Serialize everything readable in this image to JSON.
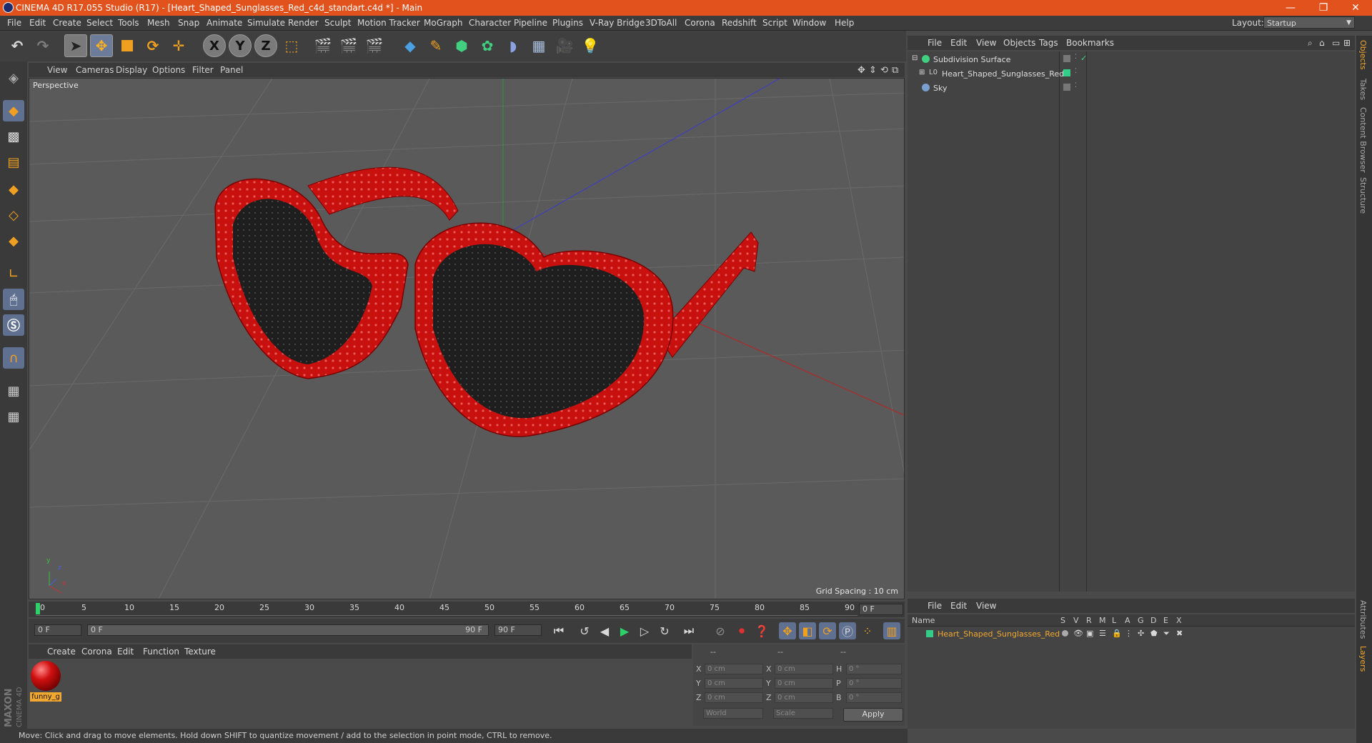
{
  "window": {
    "title": "CINEMA 4D R17.055 Studio (R17) - [Heart_Shaped_Sunglasses_Red_c4d_standart.c4d *] - Main",
    "minimize": "—",
    "restore": "❐",
    "close": "✕"
  },
  "menubar": {
    "items": [
      "File",
      "Edit",
      "Create",
      "Select",
      "Tools",
      "Mesh",
      "Snap",
      "Animate",
      "Simulate",
      "Render",
      "Sculpt",
      "Motion Tracker",
      "MoGraph",
      "Character",
      "Pipeline",
      "Plugins",
      "V-Ray Bridge",
      "3DToAll",
      "Corona",
      "Redshift",
      "Script",
      "Window",
      "Help"
    ],
    "layout_label": "Layout:",
    "layout_value": "Startup"
  },
  "toolbar": {
    "x_label": "X",
    "y_label": "Y",
    "z_label": "Z"
  },
  "viewport": {
    "menu": [
      "View",
      "Cameras",
      "Display",
      "Options",
      "Filter",
      "Panel"
    ],
    "label": "Perspective",
    "grid_spacing": "Grid Spacing : 10 cm",
    "axis_y": "y",
    "axis_z": "z",
    "axis_x": "x"
  },
  "timeline": {
    "ticks": [
      "0",
      "5",
      "10",
      "15",
      "20",
      "25",
      "30",
      "35",
      "40",
      "45",
      "50",
      "55",
      "60",
      "65",
      "70",
      "75",
      "80",
      "85",
      "90"
    ],
    "current_frame": "0 F",
    "start_field": "0 F",
    "range_start": "0 F",
    "range_end": "90 F",
    "end_field": "90 F"
  },
  "material_manager": {
    "menu": [
      "Create",
      "Corona",
      "Edit",
      "Function",
      "Texture"
    ],
    "material_name": "funny_g"
  },
  "coordinates": {
    "headers": [
      "--",
      "--",
      "--"
    ],
    "rows": [
      {
        "l1": "X",
        "v1": "0 cm",
        "l2": "X",
        "v2": "0 cm",
        "l3": "H",
        "v3": "0 °"
      },
      {
        "l1": "Y",
        "v1": "0 cm",
        "l2": "Y",
        "v2": "0 cm",
        "l3": "P",
        "v3": "0 °"
      },
      {
        "l1": "Z",
        "v1": "0 cm",
        "l2": "Z",
        "v2": "0 cm",
        "l3": "B",
        "v3": "0 °"
      }
    ],
    "mode1": "World",
    "mode2": "Scale",
    "apply": "Apply"
  },
  "status": "Move: Click and drag to move elements. Hold down SHIFT to quantize movement / add to the selection in point mode, CTRL to remove.",
  "object_manager": {
    "menu": [
      "File",
      "Edit",
      "View",
      "Objects",
      "Tags",
      "Bookmarks"
    ],
    "objects": [
      "Subdivision Surface",
      "Heart_Shaped_Sunglasses_Red",
      "Sky"
    ]
  },
  "layer_manager": {
    "menu": [
      "File",
      "Edit",
      "View"
    ],
    "headers": [
      "Name",
      "S",
      "V",
      "R",
      "M",
      "L",
      "A",
      "G",
      "D",
      "E",
      "X"
    ],
    "layer_name": "Heart_Shaped_Sunglasses_Red"
  },
  "right_tabs": [
    "Objects",
    "Takes",
    "Content Browser",
    "Structure",
    "Attributes",
    "Layers"
  ],
  "colors": {
    "title_bar": "#e2521d",
    "frame_red": "#c8100e",
    "layer_green": "#33cc88",
    "material_tag": "#f0a830"
  }
}
